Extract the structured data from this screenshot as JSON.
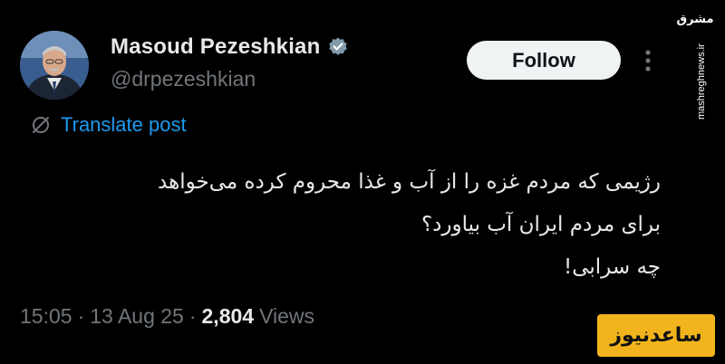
{
  "author": {
    "display_name": "Masoud Pezeshkian",
    "handle": "@drpezeshkian",
    "verified": true
  },
  "follow_label": "Follow",
  "translate_label": "Translate post",
  "tweet": {
    "lines": [
      "رژیمی که مردم غزه را از آب و غذا محروم کرده می‌خواهد",
      "برای مردم ایران آب بیاورد؟",
      "چه سرابی!"
    ]
  },
  "meta": {
    "time": "15:05",
    "separator1": "·",
    "date": "13 Aug 25",
    "separator2": "·",
    "views_count": "2,804",
    "views_label": "Views"
  },
  "watermark": {
    "side_logo": "مشرق",
    "side_url": "mashreghnews.ir",
    "badge_text": "ساعدنیوز"
  },
  "colors": {
    "background": "#000000",
    "text_primary": "#e7e9ea",
    "text_secondary": "#71767b",
    "link_blue": "#1d9bf0",
    "follow_bg": "#eff3f4",
    "badge_yellow": "#f2b41c"
  },
  "icons": {
    "verified": "verified-badge-icon",
    "more": "more-vertical-icon",
    "translate": "translate-globe-icon"
  }
}
